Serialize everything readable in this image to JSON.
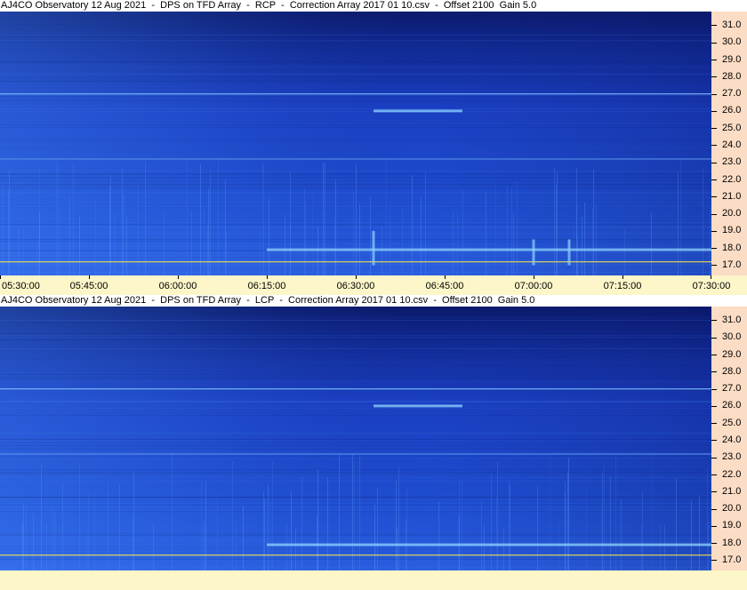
{
  "panels": [
    {
      "title": "AJ4CO Observatory 12 Aug 2021  -  DPS on TFD Array  -  RCP  -  Correction Array 2017 01 10.csv  -  Offset 2100  Gain 5.0",
      "show_time_labels": true
    },
    {
      "title": "AJ4CO Observatory 12 Aug 2021  -  DPS on TFD Array  -  LCP  -  Correction Array 2017 01 10.csv  -  Offset 2100  Gain 5.0",
      "show_time_labels": false
    }
  ],
  "chart_data": [
    {
      "type": "heatmap",
      "title": "AJ4CO Observatory 12 Aug 2021  -  DPS on TFD Array  -  RCP  -  Correction Array 2017 01 10.csv  -  Offset 2100  Gain 5.0",
      "x_tick_labels": [
        "05:30:00",
        "05:45:00",
        "06:00:00",
        "06:15:00",
        "06:30:00",
        "06:45:00",
        "07:00:00",
        "07:15:00",
        "07:30:00"
      ],
      "xlim": [
        "05:30:00",
        "07:30:00"
      ],
      "y_tick_labels": [
        "17.0",
        "18.0",
        "19.0",
        "20.0",
        "21.0",
        "22.0",
        "23.0",
        "24.0",
        "25.0",
        "26.0",
        "27.0",
        "28.0",
        "29.0",
        "30.0",
        "31.0"
      ],
      "y_ticks": [
        17,
        18,
        19,
        20,
        21,
        22,
        23,
        24,
        25,
        26,
        27,
        28,
        29,
        30,
        31
      ],
      "ylim": [
        16.4,
        31.8
      ],
      "colormap": [
        "#0b1a6b",
        "#1a3ec0",
        "#3a78f0",
        "#8fd4ff"
      ],
      "features": [
        {
          "kind": "horizontal_line",
          "freq": 17.2,
          "t_start": "05:30:00",
          "t_end": "07:30:00",
          "color": "#f2e24a"
        },
        {
          "kind": "horizontal_line",
          "freq": 27.0,
          "t_start": "05:30:00",
          "t_end": "07:30:00",
          "color": "#7fc0ff"
        },
        {
          "kind": "horizontal_line",
          "freq": 23.2,
          "t_start": "05:30:00",
          "t_end": "07:30:00",
          "color": "#5a90e8"
        },
        {
          "kind": "horizontal_band",
          "freq": 17.9,
          "t_start": "06:15:00",
          "t_end": "07:30:00",
          "color": "#8fd4ff"
        },
        {
          "kind": "horizontal_band",
          "freq": 26.0,
          "t_start": "06:33:00",
          "t_end": "06:48:00",
          "color": "#8fd4ff"
        },
        {
          "kind": "burst",
          "time": "06:33:00",
          "freq_low": 17.0,
          "freq_high": 19.0
        },
        {
          "kind": "burst",
          "time": "07:00:00",
          "freq_low": 17.0,
          "freq_high": 18.5
        },
        {
          "kind": "burst",
          "time": "07:06:00",
          "freq_low": 17.0,
          "freq_high": 18.5
        }
      ]
    },
    {
      "type": "heatmap",
      "title": "AJ4CO Observatory 12 Aug 2021  -  DPS on TFD Array  -  LCP  -  Correction Array 2017 01 10.csv  -  Offset 2100  Gain 5.0",
      "xlim": [
        "05:30:00",
        "07:30:00"
      ],
      "y_tick_labels": [
        "17.0",
        "18.0",
        "19.0",
        "20.0",
        "21.0",
        "22.0",
        "23.0",
        "24.0",
        "25.0",
        "26.0",
        "27.0",
        "28.0",
        "29.0",
        "30.0",
        "31.0"
      ],
      "y_ticks": [
        17,
        18,
        19,
        20,
        21,
        22,
        23,
        24,
        25,
        26,
        27,
        28,
        29,
        30,
        31
      ],
      "ylim": [
        16.4,
        31.8
      ],
      "colormap": [
        "#0b1a6b",
        "#1a3ec0",
        "#3a78f0",
        "#8fd4ff"
      ],
      "features": [
        {
          "kind": "horizontal_line",
          "freq": 17.3,
          "t_start": "05:30:00",
          "t_end": "07:30:00",
          "color": "#f2e24a"
        },
        {
          "kind": "horizontal_line",
          "freq": 27.0,
          "t_start": "05:30:00",
          "t_end": "07:30:00",
          "color": "#7fc0ff"
        },
        {
          "kind": "horizontal_line",
          "freq": 23.2,
          "t_start": "05:30:00",
          "t_end": "07:30:00",
          "color": "#5a90e8"
        },
        {
          "kind": "horizontal_band",
          "freq": 17.9,
          "t_start": "06:15:00",
          "t_end": "07:30:00",
          "color": "#8fd4ff"
        },
        {
          "kind": "horizontal_band",
          "freq": 26.0,
          "t_start": "06:33:00",
          "t_end": "06:48:00",
          "color": "#8fd4ff"
        }
      ]
    }
  ]
}
